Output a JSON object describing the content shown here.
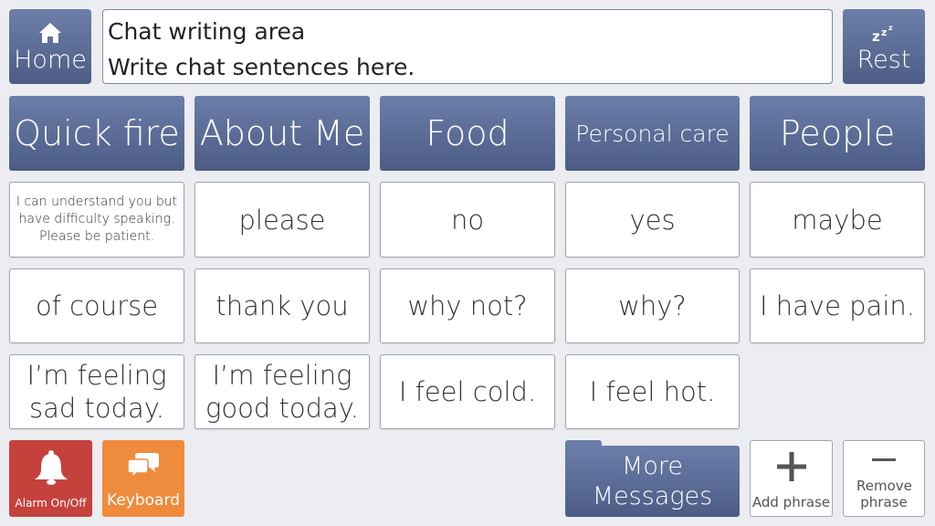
{
  "top": {
    "home_label": "Home",
    "home_icon": "home-icon",
    "rest_label": "Rest",
    "rest_icon": "sleep-zzz-icon",
    "chat_title": "Chat writing area",
    "chat_placeholder": "Write chat sentences here."
  },
  "categories": [
    {
      "label": "Quick fire"
    },
    {
      "label": "About Me"
    },
    {
      "label": "Food"
    },
    {
      "label": "Personal care"
    },
    {
      "label": "People"
    }
  ],
  "phrases": [
    {
      "label": "I can understand you but have difficulty speaking. Please be patient."
    },
    {
      "label": "please"
    },
    {
      "label": "no"
    },
    {
      "label": "yes"
    },
    {
      "label": "maybe"
    },
    {
      "label": "of course"
    },
    {
      "label": "thank you"
    },
    {
      "label": "why not?"
    },
    {
      "label": "why?"
    },
    {
      "label": "I have pain."
    },
    {
      "label": "I’m feeling sad today."
    },
    {
      "label": "I’m feeling good today."
    },
    {
      "label": "I feel cold."
    },
    {
      "label": "I feel hot."
    }
  ],
  "bottom": {
    "alarm_label": "Alarm On/Off",
    "alarm_icon": "bell-icon",
    "keyboard_label": "Keyboard",
    "keyboard_icon": "chat-bubbles-icon",
    "more_label": "More Messages",
    "add_label": "Add phrase",
    "add_icon": "plus-icon",
    "remove_label": "Remove phrase",
    "remove_icon": "minus-icon"
  },
  "colors": {
    "category_blue": "#5a6b95",
    "alarm_red": "#c5413c",
    "keyboard_orange": "#ef8b3c",
    "background": "#ecedf0"
  }
}
